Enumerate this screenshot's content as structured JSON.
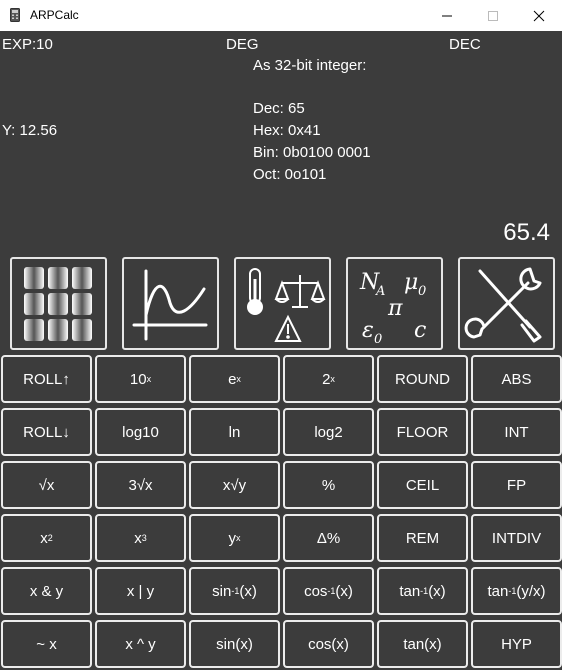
{
  "window": {
    "title": "ARPCalc"
  },
  "status": {
    "exp": "EXP:10",
    "angle": "DEG",
    "base": "DEC"
  },
  "info": {
    "header": "As 32-bit integer:",
    "dec": "Dec: 65",
    "hex": "Hex: 0x41",
    "bin": "Bin: 0b0100 0001",
    "oct": "Oct: 0o101"
  },
  "stack": {
    "y": "Y: 12.56",
    "x": "65.4"
  },
  "constants_icon": {
    "na": "N",
    "na_sub": "A",
    "mu": "μ",
    "mu_sub": "0",
    "pi": "π",
    "eps": "ε",
    "eps_sub": "0",
    "c": "c"
  },
  "toolbar": [
    {
      "name": "menu-grid-icon"
    },
    {
      "name": "graph-icon"
    },
    {
      "name": "units-conversion-icon"
    },
    {
      "name": "constants-icon"
    },
    {
      "name": "tools-icon"
    }
  ],
  "keys": [
    [
      {
        "t": "ROLL↑"
      },
      {
        "t": "10",
        "s": "x"
      },
      {
        "t": "e",
        "s": "x"
      },
      {
        "t": "2",
        "s": "x"
      },
      {
        "t": "ROUND"
      },
      {
        "t": "ABS"
      }
    ],
    [
      {
        "t": "ROLL↓"
      },
      {
        "t": "log10"
      },
      {
        "t": "ln"
      },
      {
        "t": "log2"
      },
      {
        "t": "FLOOR"
      },
      {
        "t": "INT"
      }
    ],
    [
      {
        "t": "√x"
      },
      {
        "t": "3√x"
      },
      {
        "t": "x√y"
      },
      {
        "t": "%"
      },
      {
        "t": "CEIL"
      },
      {
        "t": "FP"
      }
    ],
    [
      {
        "t": "x",
        "s": "2"
      },
      {
        "t": "x",
        "s": "3"
      },
      {
        "t": "y",
        "s": "x"
      },
      {
        "t": "Δ%"
      },
      {
        "t": "REM"
      },
      {
        "t": "INTDIV"
      }
    ],
    [
      {
        "t": "x & y"
      },
      {
        "t": "x | y"
      },
      {
        "t": "sin",
        "s": "-1",
        "a": "(x)"
      },
      {
        "t": "cos",
        "s": "-1",
        "a": "(x)"
      },
      {
        "t": "tan",
        "s": "-1",
        "a": "(x)"
      },
      {
        "t": "tan",
        "s": "-1",
        "a": "(y/x)"
      }
    ],
    [
      {
        "t": "~ x"
      },
      {
        "t": "x ^ y"
      },
      {
        "t": "sin(x)"
      },
      {
        "t": "cos(x)"
      },
      {
        "t": "tan(x)"
      },
      {
        "t": "HYP"
      }
    ]
  ]
}
